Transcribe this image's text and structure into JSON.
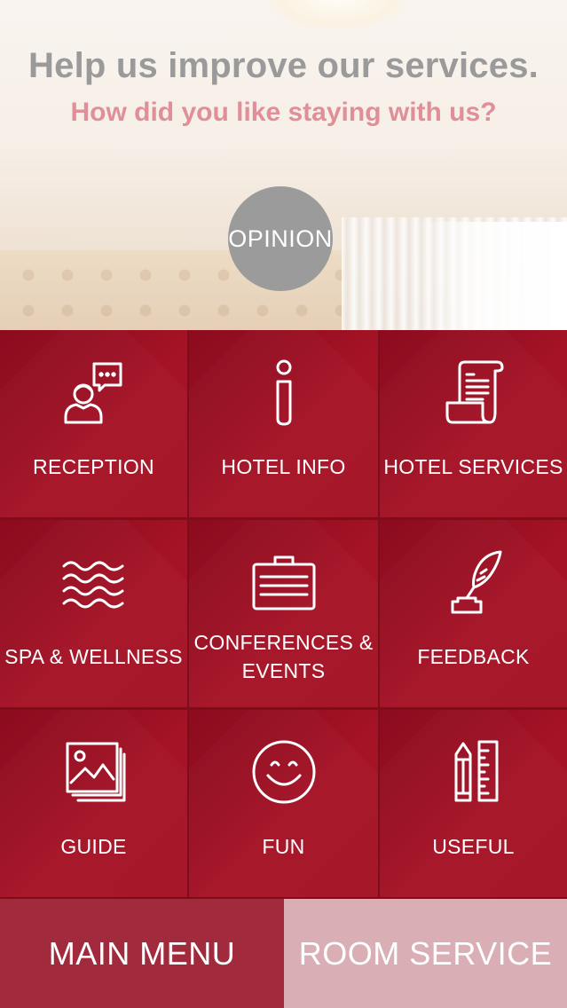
{
  "hero": {
    "title": "Help us improve our services.",
    "subtitle": "How did you like staying with us?",
    "opinion_button": "OPINION"
  },
  "menu": {
    "items": [
      {
        "label": "RECEPTION",
        "icon": "reception-icon"
      },
      {
        "label": "HOTEL INFO",
        "icon": "info-icon"
      },
      {
        "label": "HOTEL SERVICES",
        "icon": "document-list-icon"
      },
      {
        "label": "SPA & WELLNESS",
        "icon": "waves-icon"
      },
      {
        "label_line1": "CONFERENCES &",
        "label_line2": "EVENTS",
        "icon": "briefcase-icon"
      },
      {
        "label": "FEEDBACK",
        "icon": "quill-inkwell-icon"
      },
      {
        "label": "GUIDE",
        "icon": "photo-gallery-icon"
      },
      {
        "label": "FUN",
        "icon": "smiley-icon"
      },
      {
        "label": "USEFUL",
        "icon": "pencil-ruler-icon"
      }
    ]
  },
  "bottom": {
    "main_menu": "MAIN MENU",
    "room_service": "ROOM SERVICE"
  },
  "colors": {
    "tile_red": "#a01024",
    "title_gray": "#9a9a9a",
    "subtitle_pink": "#e08e98",
    "main_menu_bg": "#a12b3c",
    "room_service_bg": "#d9aeb5"
  }
}
